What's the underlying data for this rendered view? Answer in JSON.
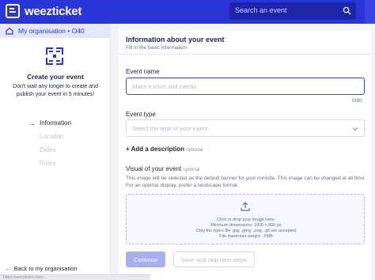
{
  "app": {
    "brand": "weezticket",
    "accent": "#2a35d8"
  },
  "search": {
    "placeholder": "Search an event",
    "icon": "search-icon"
  },
  "sidebar": {
    "org_label": "My organisation • O40",
    "create_title": "Create your event",
    "create_desc": "Don't wait any longer to create and publish your event in 5 minutes!",
    "steps": [
      {
        "label": "Information",
        "active": true
      },
      {
        "label": "Location",
        "active": false
      },
      {
        "label": "Dates",
        "active": false
      },
      {
        "label": "Rates",
        "active": false
      }
    ],
    "back_label": "Back to my organisation"
  },
  "form": {
    "title": "Information about your event",
    "subtitle": "Fill in the basic information",
    "event_name_label": "Event name",
    "event_name_placeholder": "Make it short and catchy",
    "counter": "0/80",
    "event_type_label": "Event type",
    "event_type_placeholder": "Select the type of your event",
    "add_description": "+ Add a description",
    "optional": "optional",
    "visual_label": "Visual of your event",
    "visual_desc": "This image will be selected as the default banner for your minisite. This image can be changed at all time. For an optimal display, prefer a landscape format.",
    "drop_line1": "Click or drop your image here.",
    "drop_line2": "Minimum dimensions: 1600 x 800 px",
    "drop_line3": "Only the types file .jpg, .jpeg, .png, .gif are accepted",
    "drop_line4": "File maximum weight : 2MB",
    "continue_label": "Continue",
    "skip_label": "Save and skip next steps"
  },
  "statusbar": {
    "url": "https://weezticket.com/..."
  }
}
